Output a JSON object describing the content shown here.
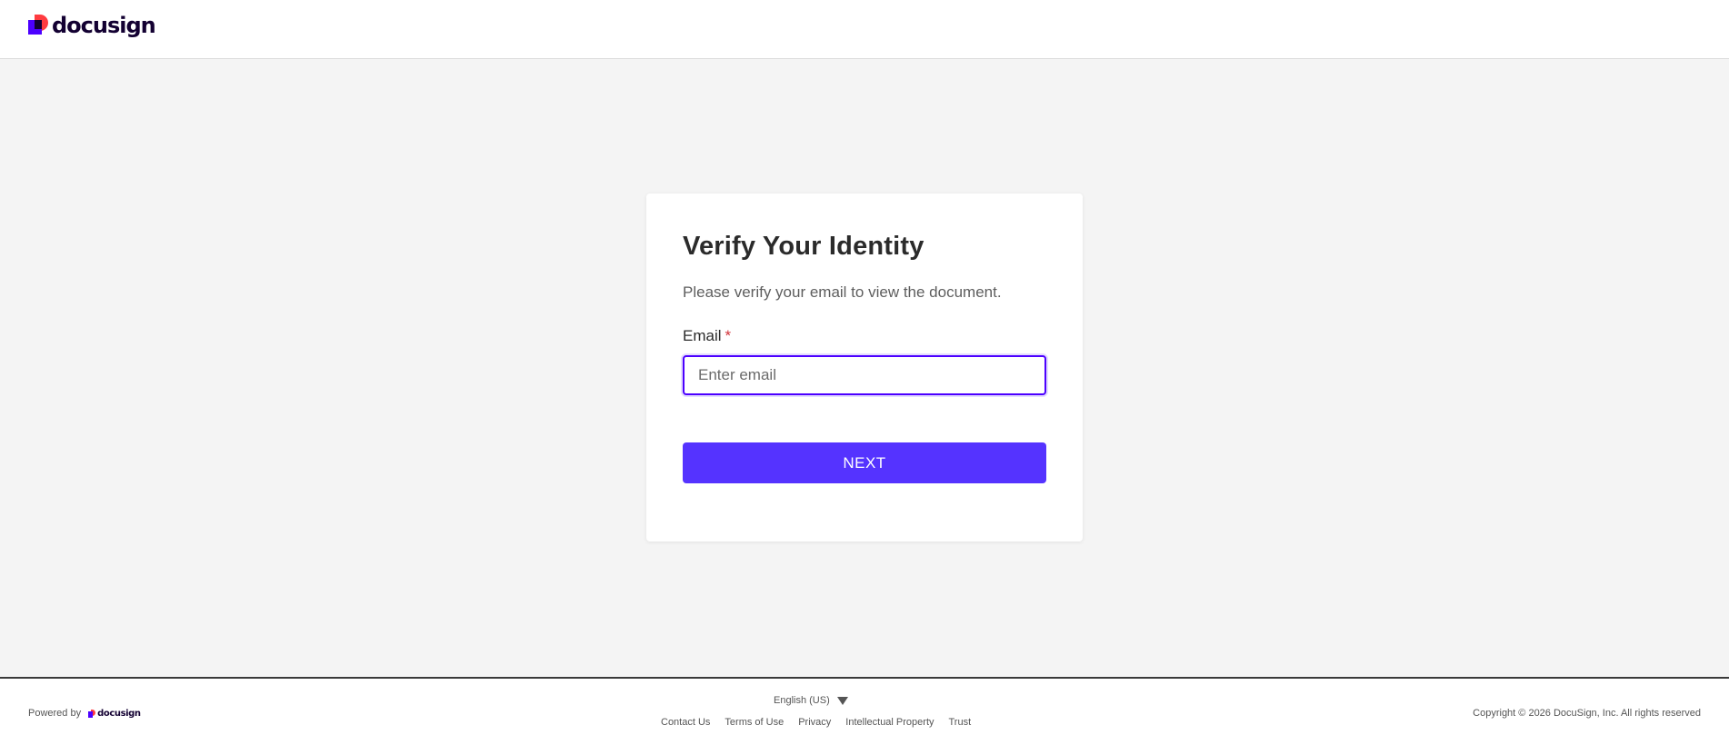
{
  "header": {
    "logo_text": "docusign",
    "logo_colors": {
      "red": "#ff3b40",
      "blue": "#4c00ff",
      "dark": "#130032"
    }
  },
  "card": {
    "title": "Verify Your Identity",
    "subtitle": "Please verify your email to view the document.",
    "email_label": "Email",
    "required_marker": "*",
    "email_placeholder": "Enter email",
    "email_value": "",
    "next_button": "NEXT",
    "accent_color": "#5533ff"
  },
  "footer": {
    "powered_by": "Powered by",
    "powered_logo_text": "docusign",
    "language": "English (US)",
    "links": [
      "Contact Us",
      "Terms of Use",
      "Privacy",
      "Intellectual Property",
      "Trust"
    ],
    "copyright": "Copyright © 2026 DocuSign, Inc. All rights reserved"
  },
  "icons": [
    "docusign-logo-icon",
    "dropdown-triangle-icon"
  ]
}
